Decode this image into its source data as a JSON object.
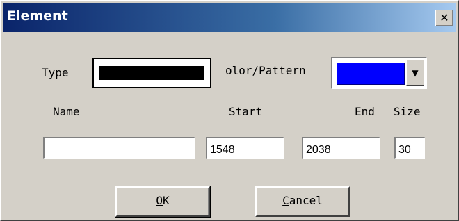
{
  "window": {
    "title": "Element",
    "close_glyph": "✕"
  },
  "labels": {
    "type": "Type",
    "color_pattern": "olor/Pattern",
    "name": "Name",
    "start": "Start",
    "end": "End",
    "size": "Size"
  },
  "type_swatch": {
    "color": "#000000"
  },
  "color_combo": {
    "selected_color": "#0000ff",
    "arrow_icon": "chevron-down-icon"
  },
  "fields": {
    "name": "",
    "start": "1548",
    "end": "2038",
    "size": "30"
  },
  "buttons": {
    "ok_accel": "O",
    "ok_rest": "K",
    "cancel_accel": "C",
    "cancel_rest": "ancel"
  }
}
